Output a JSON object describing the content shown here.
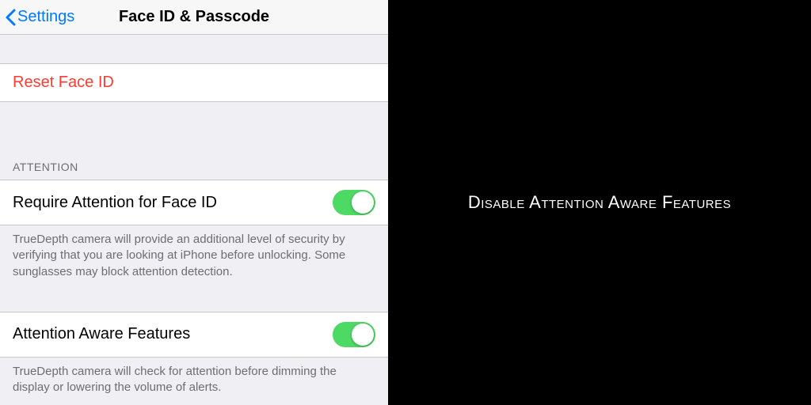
{
  "header": {
    "back_label": "Settings",
    "title": "Face ID & Passcode"
  },
  "rows": {
    "reset_label": "Reset Face ID",
    "require_label": "Require Attention for Face ID",
    "aware_label": "Attention Aware Features"
  },
  "sections": {
    "attention_header": "ATTENTION",
    "require_footer": "TrueDepth camera will provide an additional level of security by verifying that you are looking at iPhone before unlocking. Some sunglasses may block attention detection.",
    "aware_footer": "TrueDepth camera will check for attention before dimming the display or lowering the volume of alerts."
  },
  "toggles": {
    "require_on": true,
    "aware_on": true
  },
  "caption": "Disable Attention Aware Features",
  "colors": {
    "accent": "#007aff",
    "destructive": "#ff3b30",
    "toggle_on": "#4cd964"
  }
}
